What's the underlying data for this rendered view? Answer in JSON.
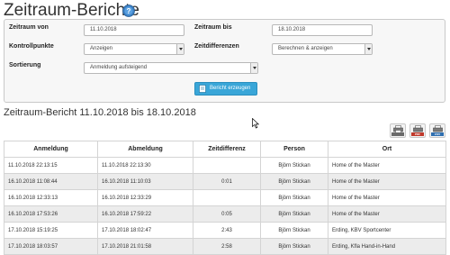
{
  "page": {
    "title": "Zeitraum-Berichte"
  },
  "filters": {
    "zeitraum_von_label": "Zeitraum von",
    "zeitraum_von_value": "11.10.2018",
    "zeitraum_bis_label": "Zeitraum bis",
    "zeitraum_bis_value": "18.10.2018",
    "kontrollpunkte_label": "Kontrollpunkte",
    "kontrollpunkte_value": "Anzeigen",
    "zeitdifferenzen_label": "Zeitdifferenzen",
    "zeitdifferenzen_value": "Berechnen & anzeigen",
    "sortierung_label": "Sortierung",
    "sortierung_value": "Anmeldung aufsteigend",
    "submit_label": "Bericht erzeugen"
  },
  "report": {
    "heading": "Zeitraum-Bericht 11.10.2018 bis 18.10.2018",
    "export_buttons": [
      {
        "icon": "print-icon",
        "tag": "",
        "color": "#6a6a6a"
      },
      {
        "icon": "pdf-export-icon",
        "tag": "PDF",
        "color": "#c0392b"
      },
      {
        "icon": "csv-export-icon",
        "tag": "CSV",
        "color": "#2f6fb0"
      }
    ],
    "columns": [
      "Anmeldung",
      "Abmeldung",
      "Zeitdifferenz",
      "Person",
      "Ort"
    ],
    "rows": [
      [
        "11.10.2018 22:13:15",
        "11.10.2018 22:13:30",
        "",
        "Björn Stickan",
        "Home of the Master"
      ],
      [
        "16.10.2018 11:08:44",
        "16.10.2018 11:10:03",
        "0:01",
        "Björn Stickan",
        "Home of the Master"
      ],
      [
        "16.10.2018 12:33:13",
        "16.10.2018 12:33:29",
        "",
        "Björn Stickan",
        "Home of the Master"
      ],
      [
        "16.10.2018 17:53:26",
        "16.10.2018 17:59:22",
        "0:05",
        "Björn Stickan",
        "Home of the Master"
      ],
      [
        "17.10.2018 15:19:25",
        "17.10.2018 18:02:47",
        "2:43",
        "Björn Stickan",
        "Erding, KBV Sportcenter"
      ],
      [
        "17.10.2018 18:03:57",
        "17.10.2018 21:01:58",
        "2:58",
        "Björn Stickan",
        "Erding, Kfla Hand-in-Hand"
      ]
    ]
  },
  "colors": {
    "accent": "#39a6d8",
    "row_stripe": "#ececec",
    "panel_bg": "#f7f7f7"
  }
}
